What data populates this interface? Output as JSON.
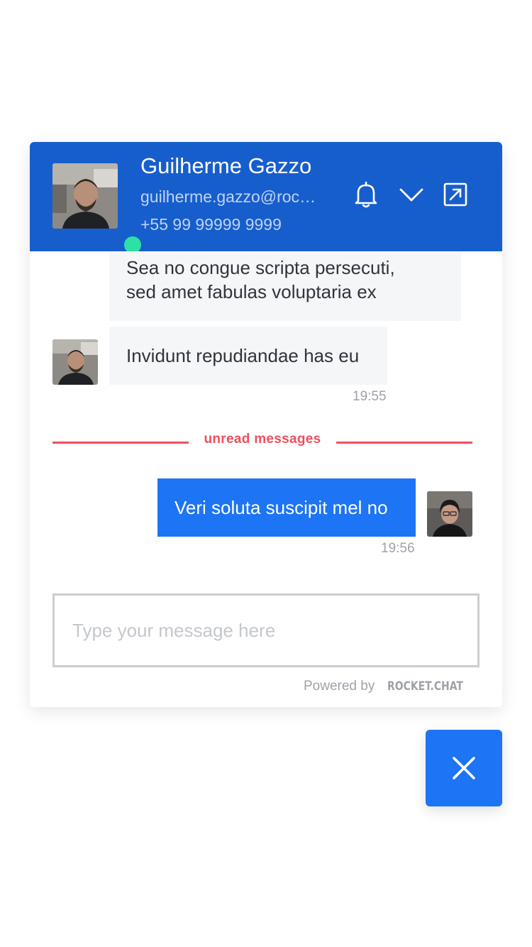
{
  "header": {
    "agent_name": "Guilherme Gazzo",
    "agent_email": "guilherme.gazzo@rocket.chat",
    "agent_phone": "+55 99 99999 9999",
    "status": "online",
    "icons": [
      "bell-icon",
      "chevron-down-icon",
      "pop-out-icon"
    ],
    "background_color": "#175ecd",
    "status_color": "#2de0a5"
  },
  "messages": [
    {
      "direction": "incoming",
      "text_line1": "Sea no congue scripta persecuti,",
      "text_line2": "sed amet fabulas voluptaria ex"
    },
    {
      "direction": "incoming",
      "text": "Invidunt repudiandae has eu",
      "time": "19:55"
    },
    {
      "direction": "outgoing",
      "text": "Veri soluta suscipit mel no",
      "time": "19:56"
    }
  ],
  "unread_separator": {
    "label": "unread messages",
    "color": "#ef4f5e"
  },
  "composer": {
    "placeholder": "Type your message here",
    "value": ""
  },
  "footer": {
    "powered_by": "Powered by",
    "brand": "ROCKET.CHAT"
  },
  "close_button": {
    "icon": "close-icon",
    "color": "#1d74f5"
  }
}
